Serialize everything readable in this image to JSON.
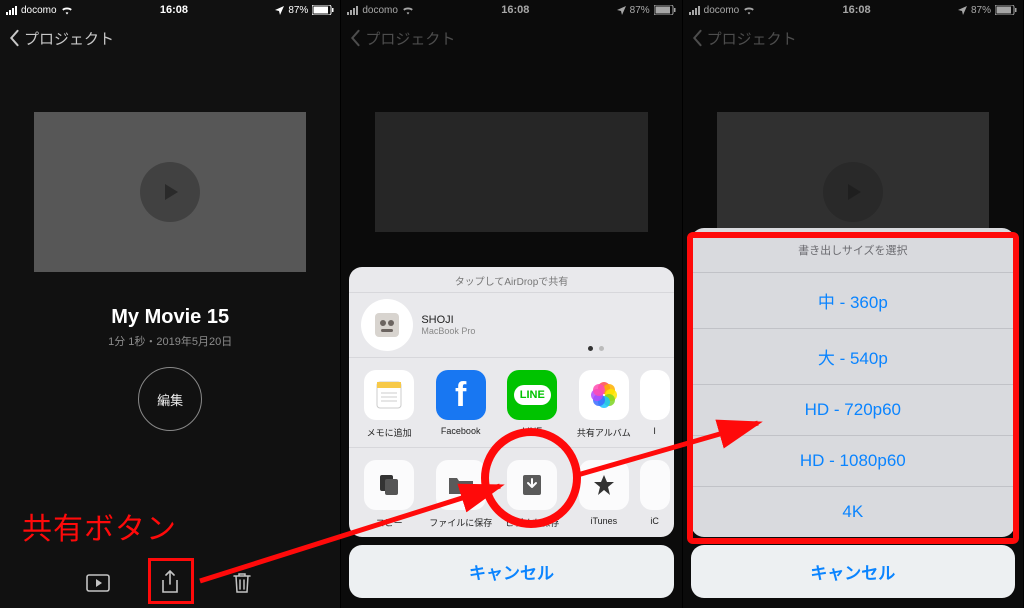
{
  "status": {
    "carrier": "docomo",
    "time": "16:08",
    "battery": "87%"
  },
  "nav": {
    "back_label": "プロジェクト"
  },
  "screen1": {
    "title": "My Movie 15",
    "subtitle": "1分 1秒・2019年5月20日",
    "edit_label": "編集",
    "annotation_label": "共有ボタン"
  },
  "share_sheet": {
    "header": "タップしてAirDropで共有",
    "airdrop": {
      "name": "SHOJI",
      "device": "MacBook Pro"
    },
    "apps": [
      {
        "label": "メモに追加",
        "icon": "memo",
        "bg": "#ffffff",
        "fg": "#f7b500"
      },
      {
        "label": "Facebook",
        "icon": "fb",
        "bg": "#1877f2",
        "fg": "#ffffff"
      },
      {
        "label": "LINE",
        "icon": "line",
        "bg": "#00c300",
        "fg": "#ffffff"
      },
      {
        "label": "共有アルバム",
        "icon": "photos",
        "bg": "#ffffff",
        "fg": ""
      },
      {
        "label": "I",
        "icon": "generic",
        "bg": "#ffffff",
        "fg": "#555"
      }
    ],
    "actions": [
      {
        "label": "コピー",
        "icon": "copy"
      },
      {
        "label": "ファイルに保存",
        "icon": "folder"
      },
      {
        "label": "ビデオを保存",
        "icon": "save-video"
      },
      {
        "label": "iTunes",
        "icon": "star"
      },
      {
        "label": "iC",
        "icon": "generic"
      }
    ],
    "cancel": "キャンセル"
  },
  "export_sheet": {
    "title": "書き出しサイズを選択",
    "options": [
      "中 - 360p",
      "大 - 540p",
      "HD - 720p60",
      "HD - 1080p60",
      "4K"
    ],
    "cancel": "キャンセル"
  },
  "colors": {
    "accent": "#0a84ff",
    "anno": "#ff0a0a"
  }
}
